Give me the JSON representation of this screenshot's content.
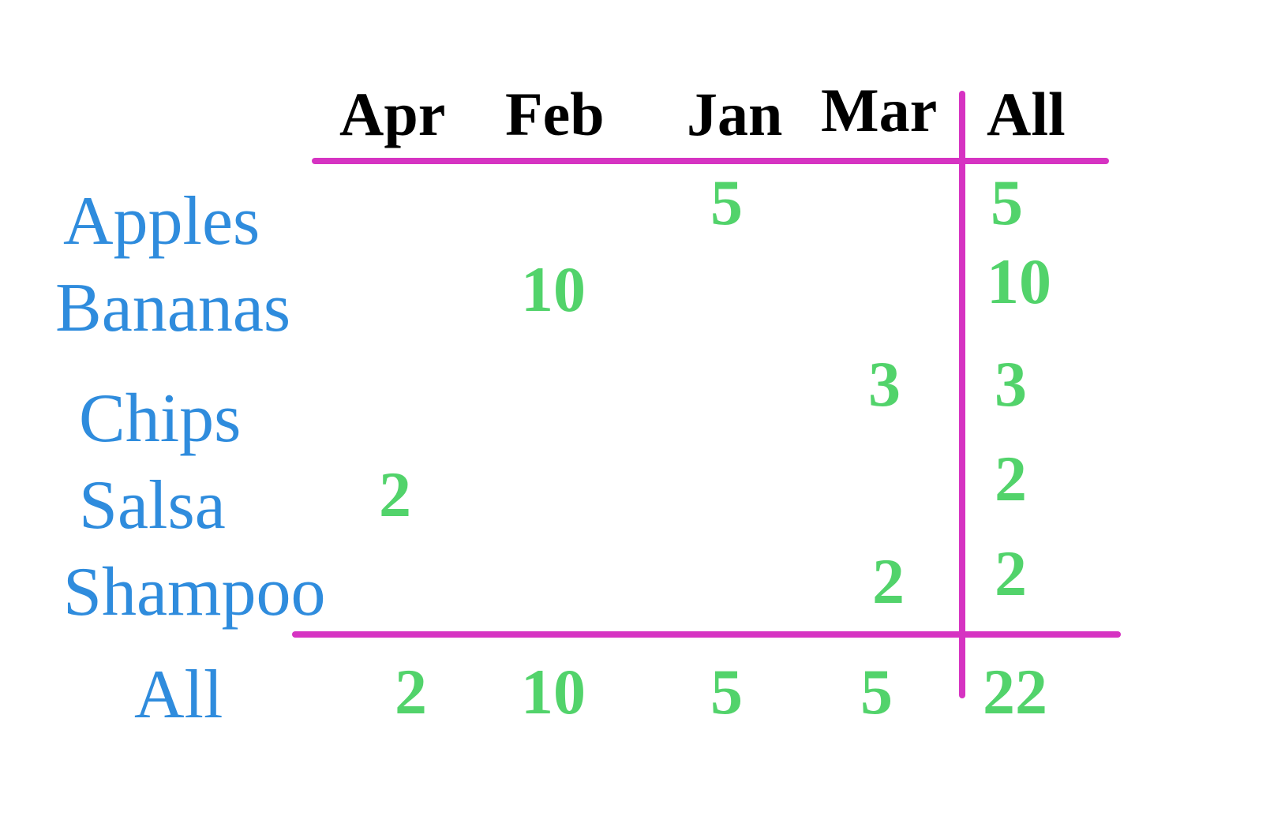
{
  "chart_data": {
    "type": "table",
    "title": "",
    "columns": [
      "Apr",
      "Feb",
      "Jan",
      "Mar",
      "All"
    ],
    "rows": [
      "Apples",
      "Bananas",
      "Chips",
      "Salsa",
      "Shampoo",
      "All"
    ],
    "cells": {
      "Apples": {
        "Apr": null,
        "Feb": null,
        "Jan": 5,
        "Mar": null,
        "All": 5
      },
      "Bananas": {
        "Apr": null,
        "Feb": 10,
        "Jan": null,
        "Mar": null,
        "All": 10
      },
      "Chips": {
        "Apr": null,
        "Feb": null,
        "Jan": null,
        "Mar": 3,
        "All": 3
      },
      "Salsa": {
        "Apr": 2,
        "Feb": null,
        "Jan": null,
        "Mar": null,
        "All": 2
      },
      "Shampoo": {
        "Apr": null,
        "Feb": null,
        "Jan": null,
        "Mar": 2,
        "All": 2
      },
      "All": {
        "Apr": 2,
        "Feb": 10,
        "Jan": 5,
        "Mar": 5,
        "All": 22
      }
    }
  },
  "headers": {
    "cols": {
      "apr": "Apr",
      "feb": "Feb",
      "jan": "Jan",
      "mar": "Mar",
      "all": "All"
    },
    "rows": {
      "apples": "Apples",
      "bananas": "Bananas",
      "chips": "Chips",
      "salsa": "Salsa",
      "shampoo": "Shampoo",
      "all": "All"
    }
  },
  "values": {
    "apples_jan": "5",
    "apples_all": "5",
    "bananas_feb": "10",
    "bananas_all": "10",
    "chips_mar": "3",
    "chips_all": "3",
    "salsa_apr": "2",
    "salsa_all": "2",
    "shampoo_mar": "2",
    "shampoo_all": "2",
    "all_apr": "2",
    "all_feb": "10",
    "all_jan": "5",
    "all_mar": "5",
    "all_all": "22"
  }
}
